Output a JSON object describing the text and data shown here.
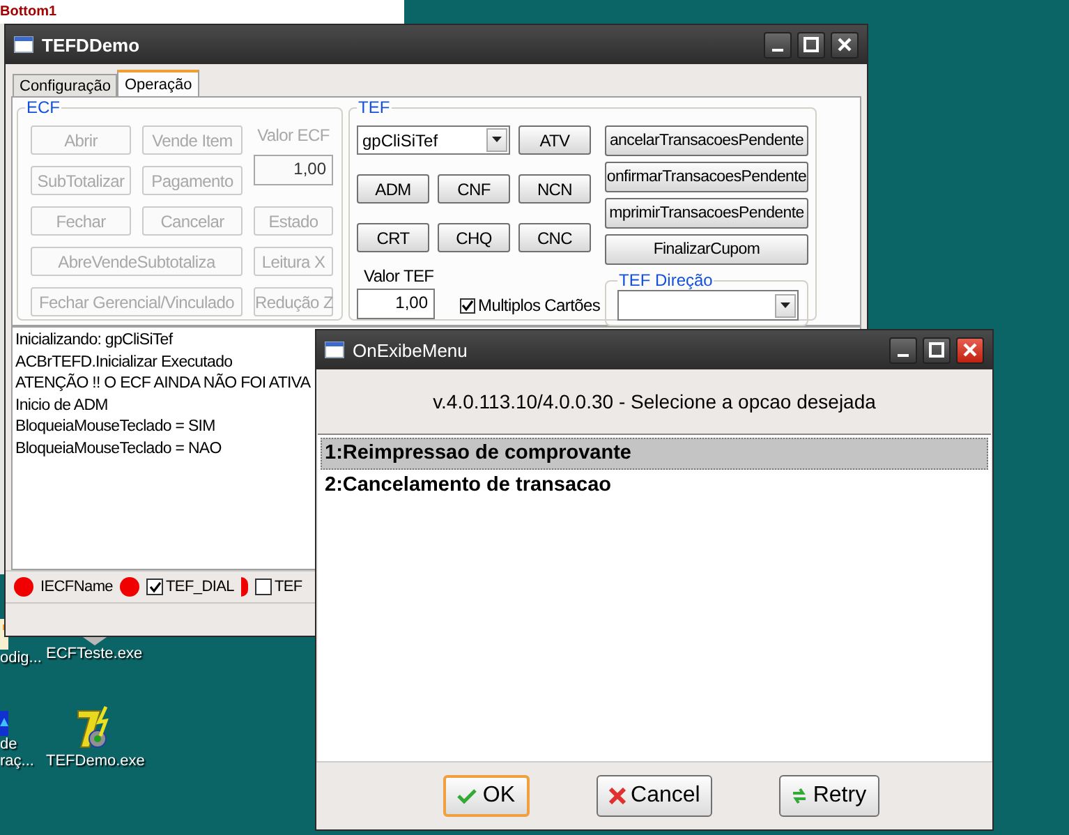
{
  "background_label": "Bottom1",
  "desktop_icons": [
    {
      "label": "odig...",
      "kind": "partial"
    },
    {
      "label": "ECFTeste.exe",
      "kind": "ecf"
    },
    {
      "label": "de raç...",
      "kind": "partial2"
    },
    {
      "label": "TEFDemo.exe",
      "kind": "tef"
    }
  ],
  "main_window": {
    "title": "TEFDDemo",
    "tabs": [
      {
        "label": "Configuração",
        "selected": false
      },
      {
        "label": "Operação",
        "selected": true
      }
    ],
    "ecf": {
      "title": "ECF",
      "items": [
        {
          "kind": "button",
          "label": "Abrir",
          "disabled": true
        },
        {
          "kind": "button",
          "label": "Vende Item",
          "disabled": true
        },
        {
          "kind": "label",
          "text": "Valor ECF",
          "disabled": true
        },
        {
          "kind": "button",
          "label": "SubTotalizar",
          "disabled": true
        },
        {
          "kind": "button",
          "label": "Pagamento",
          "disabled": true
        },
        {
          "kind": "field",
          "value": "1,00",
          "disabled": true
        },
        {
          "kind": "button",
          "label": "Fechar",
          "disabled": true
        },
        {
          "kind": "button",
          "label": "Cancelar",
          "disabled": true
        },
        {
          "kind": "button",
          "label": "Estado",
          "disabled": true
        },
        {
          "kind": "button",
          "label": "AbreVendeSubtotaliza",
          "disabled": true
        },
        {
          "kind": "button",
          "label": "Leitura X",
          "disabled": true
        },
        {
          "kind": "button",
          "label": "Fechar Gerencial/Vinculado",
          "disabled": true
        },
        {
          "kind": "button",
          "label": "Redução Z",
          "disabled": true
        }
      ]
    },
    "tef": {
      "title": "TEF",
      "gateway": "gpCliSiTef",
      "buttons": [
        "ATV",
        "ADM",
        "CNF",
        "NCN",
        "CRT",
        "CHQ",
        "CNC"
      ],
      "valor_label": "Valor TEF",
      "valor": "1,00",
      "multiplos": {
        "label": "Multiplos Cartões",
        "checked": true
      },
      "actions": [
        "ancelarTransacoesPendente",
        "onfirmarTransacoesPendente",
        "mprimirTransacoesPendente",
        "FinalizarCupom"
      ],
      "direcao_title": "TEF Direção"
    },
    "log": [
      "Inicializando: gpCliSiTef",
      "ACBrTEFD.Inicializar Executado",
      "ATENÇÃO !! O ECF AINDA NÃO FOI ATIVA",
      "Inicio de ADM",
      "BloqueiaMouseTeclado = SIM",
      "BloqueiaMouseTeclado = NAO"
    ],
    "status_bar": [
      {
        "kind": "dot"
      },
      {
        "kind": "label",
        "text": "IECFName"
      },
      {
        "kind": "dot"
      },
      {
        "kind": "checkbox",
        "label": "TEF_DIAL",
        "checked": true
      },
      {
        "kind": "halfdot"
      },
      {
        "kind": "checkbox",
        "label": "TEF",
        "checked": false
      }
    ]
  },
  "dialog": {
    "title": "OnExibeMenu",
    "header": "v.4.0.113.10/4.0.0.30 - Selecione a opcao desejada",
    "items": [
      {
        "label": "1:Reimpressao de comprovante",
        "selected": true
      },
      {
        "label": "2:Cancelamento de transacao",
        "selected": false
      }
    ],
    "buttons": [
      {
        "label": "OK",
        "kind": "ok",
        "default": true
      },
      {
        "label": "Cancel",
        "kind": "cancel",
        "default": false
      },
      {
        "label": "Retry",
        "kind": "retry",
        "default": false
      }
    ]
  }
}
